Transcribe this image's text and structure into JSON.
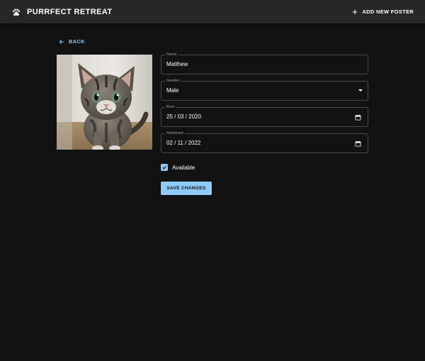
{
  "app": {
    "title": "PURRFECT RETREAT",
    "add_foster_label": "ADD NEW FOSTER"
  },
  "nav": {
    "back_label": "BACK"
  },
  "form": {
    "name": {
      "label": "Name",
      "value": "Matthew"
    },
    "gender": {
      "label": "Gender",
      "value": "Male"
    },
    "born": {
      "label": "Born",
      "value": "25 / 03 / 2020"
    },
    "sheltered": {
      "label": "Sheltered",
      "value": "02 / 11 / 2022"
    },
    "available": {
      "label": "Available",
      "checked": true
    },
    "save_label": "SAVE CHANGES"
  },
  "icons": {
    "brand": "paw-icon",
    "add": "plus-icon",
    "back": "arrow-left-icon",
    "dropdown": "caret-down-icon",
    "date": "calendar-icon",
    "check": "check-icon"
  },
  "colors": {
    "background": "#121212",
    "appbar": "#272727",
    "accent": "#90caf9",
    "field_border": "#4a4a4a",
    "label": "#9e9e9e"
  }
}
